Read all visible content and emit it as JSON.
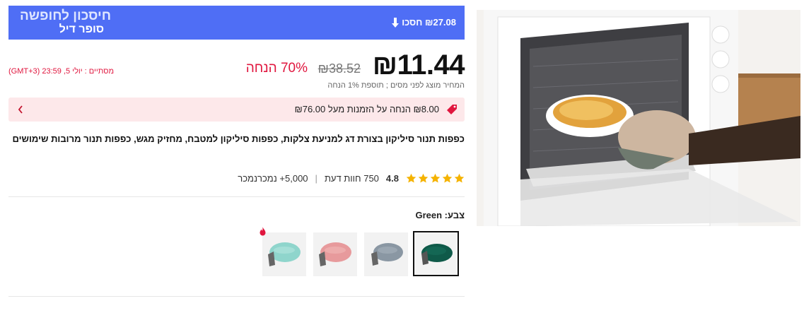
{
  "banner": {
    "title": "חיסכון לחופשה",
    "subtitle": "סופר דיל",
    "save_text": "₪27.08 חסכו"
  },
  "price": {
    "current": "₪11.44",
    "original": "₪38.52",
    "discount": "70% הנחה",
    "ends": "מסתיים : יולי 5, 23:59 (GMT+3)",
    "tax_note": "המחיר מוצג לפני מסים ; תוספת 1% הנחה"
  },
  "coupon": {
    "text": "₪8.00 הנחה על הזמנות מעל ₪76.00"
  },
  "product": {
    "title": "כפפות תנור סיליקון בצורת דג למניעת צלקות, כפפות סיליקון למטבח, מחזיק מגש, כפפות תנור מרובות שימושים"
  },
  "rating": {
    "score": "4.8",
    "reviews": "750 חוות דעת",
    "separator": "|",
    "sold": "5,000+ נמכרנמכר",
    "stars": 5
  },
  "color": {
    "label": "צבע: Green",
    "options": [
      {
        "name": "Green",
        "color": "#0f5a49",
        "selected": true
      },
      {
        "name": "Gray",
        "color": "#8a97a3",
        "selected": false
      },
      {
        "name": "Pink",
        "color": "#e79a9c",
        "selected": false
      },
      {
        "name": "Mint",
        "color": "#8fd5cc",
        "selected": false,
        "hot": true
      }
    ]
  },
  "colors": {
    "accent": "#4f6ef5",
    "sale": "#e0163e",
    "star": "#f5b301"
  }
}
